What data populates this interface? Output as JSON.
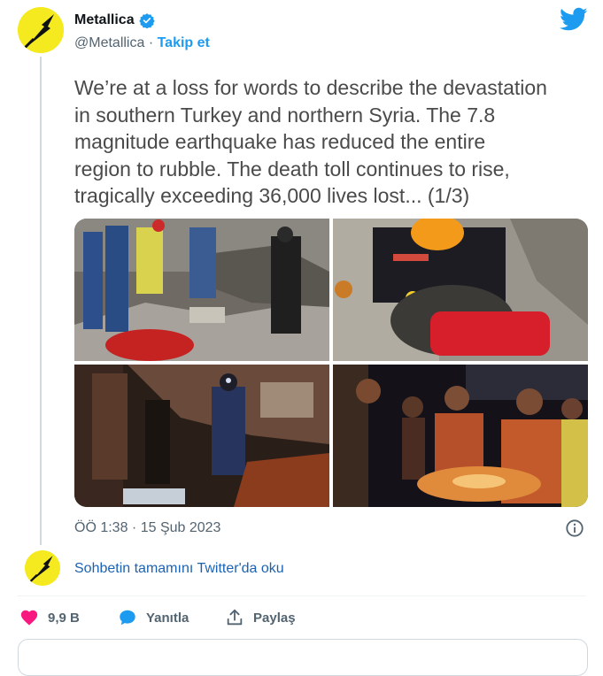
{
  "author": {
    "name": "Metallica",
    "handle": "@Metallica",
    "separator": " · ",
    "follow_label": "Takip et"
  },
  "tweet": {
    "text": "We’re at a loss for words to describe the devastation\nin southern Turkey and northern Syria. The 7.8\nmagnitude earthquake has reduced the entire\nregion to rubble. The death toll continues to rise,\ntragically exceeding 36,000 lives lost... (1/3)",
    "timestamp": "ÖÖ 1:38 · 15 Şub 2023"
  },
  "thread": {
    "continue_label": "Sohbetin tamamını Twitter'da oku"
  },
  "actions": {
    "like_count": "9,9 B",
    "reply_label": "Yanıtla",
    "share_label": "Paylaş"
  },
  "icons": {
    "verified": "verified-badge-icon",
    "brand": "twitter-bird-icon",
    "info": "info-icon",
    "like": "heart-icon",
    "reply": "speech-bubble-icon",
    "share": "share-upload-icon"
  },
  "colors": {
    "accent": "#1d9bf0",
    "like": "#f91880",
    "avatar_bg": "#f4ea1f",
    "text_secondary": "#536471"
  }
}
